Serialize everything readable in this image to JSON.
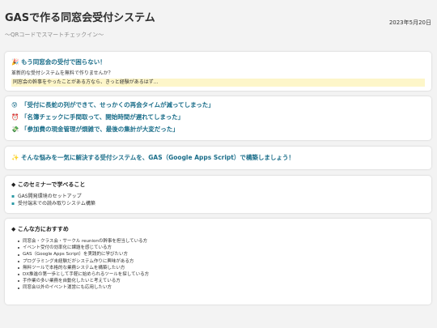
{
  "header": {
    "title": "GASで作る同窓会受付システム",
    "subtitle": "〜QRコードでスマートチェックイン〜",
    "date": "2023年5月20日"
  },
  "intro": {
    "icon": "🎉",
    "headline": "もう同窓会の受付で困らない！",
    "question": "革新的な受付システムを無料で作りませんか？",
    "highlight": "同窓会の幹事をやったことがある方なら、きっと経験があるはず..."
  },
  "pains": [
    {
      "icon": "😰",
      "text": "「受付に長蛇の列ができて、せっかくの再会タイムが減ってしまった」"
    },
    {
      "icon": "⏰",
      "text": "「名簿チェックに手間取って、開始時間が遅れてしまった」"
    },
    {
      "icon": "💸",
      "text": "「参加費の現金管理が煩雑で、最後の集計が大変だった」"
    }
  ],
  "solution": {
    "icon": "✨",
    "text": "そんな悩みを一気に解決する受付システムを、GAS（Google Apps Script）で構築しましょう！"
  },
  "learn": {
    "heading": "◆ このセミナーで学べること",
    "items": [
      "GAS開発環境のセットアップ",
      "受付端末での読み取りシステム構築"
    ]
  },
  "audience": {
    "heading": "◆ こんな方におすすめ",
    "items": [
      "同窓会・クラス会・サークル reunionの幹事を担当している方",
      "イベント受付の効率化に課題を感じている方",
      "GAS（Google Apps Script）を実践的に学びたい方",
      "プログラミング未経験だがシステム作りに興味がある方",
      "無料ツールで本格的な業務システムを構築したい方",
      "DX推進の第一歩として手軽に始められるツールを探している方",
      "手作業の多い業務を自動化したいと考えている方",
      "同窓会以外のイベント運営にも応用したい方"
    ]
  }
}
